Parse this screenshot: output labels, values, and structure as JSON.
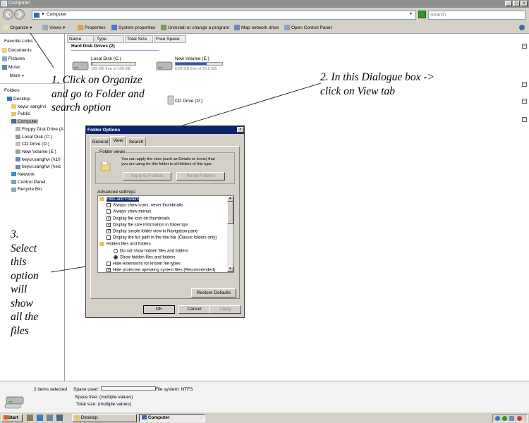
{
  "window": {
    "title": "Computer",
    "controls": [
      "_",
      "□",
      "×"
    ]
  },
  "address": {
    "path": "Computer",
    "search_placeholder": "Search"
  },
  "toolbar": {
    "organize": "Organize",
    "views": "Views",
    "properties": "Properties",
    "system_properties": "System properties",
    "uninstall": "Uninstall or change a program",
    "map_drive": "Map network drive",
    "control_panel": "Open Control Panel"
  },
  "nav": {
    "favorite_links_title": "Favorite Links",
    "favorites": [
      "Documents",
      "Pictures",
      "Music"
    ],
    "more": "More",
    "folders_title": "Folders",
    "tree": [
      "Desktop",
      "keyur sanghvi",
      "Public",
      "Computer",
      "Floppy Disk Drive (A",
      "Local Disk (C:)",
      "CD Drive (D:)",
      "New Volume (E:)",
      "keyur.sanghvi (\\\\10",
      "keyur.sanghvi (\\\\eic",
      "Network",
      "Control Panel",
      "Recycle Bin"
    ]
  },
  "columns": [
    "Name",
    "Type",
    "Total Size",
    "Free Space"
  ],
  "content": {
    "group_title": "Hard Disk Drives (2)",
    "drives": [
      {
        "name": "Local Disk (C:)",
        "free_text": "199 MB free of 200 MB",
        "used_fraction": 0.005
      },
      {
        "name": "New Volume (E:)",
        "free_text": "6.83 GB free of 20.6 GB",
        "used_fraction": 0.67
      }
    ],
    "cd_drive": "CD Drive (D:)"
  },
  "annotations": {
    "a1": [
      "1. Click on Organize",
      "and go to Folder and",
      "search option"
    ],
    "a2": [
      "2. In this Dialogue box ->",
      "click on View tab"
    ],
    "a3": [
      "3.",
      "Select",
      "this",
      "option",
      "will",
      "show",
      "all the",
      "files"
    ]
  },
  "dialog": {
    "title": "Folder Options",
    "close": "×",
    "tabs": [
      "General",
      "View",
      "Search"
    ],
    "folder_views_label": "Folder views",
    "folder_views_text": [
      "You can apply the view (such as Details or Icons) that",
      "you are using for this folder to all folders of this type."
    ],
    "apply_to_folders": "Apply to Folders",
    "reset_folders": "Reset Folders",
    "advanced_label": "Advanced settings:",
    "advanced_items": [
      {
        "kind": "folder",
        "label": "Files and Folders"
      },
      {
        "kind": "check",
        "checked": false,
        "label": "Always show icons, never thumbnails"
      },
      {
        "kind": "check",
        "checked": false,
        "label": "Always show menus"
      },
      {
        "kind": "check",
        "checked": true,
        "label": "Display file icon on thumbnails"
      },
      {
        "kind": "check",
        "checked": true,
        "label": "Display file size information in folder tips"
      },
      {
        "kind": "check",
        "checked": true,
        "label": "Display simple folder view in Navigation pane"
      },
      {
        "kind": "check",
        "checked": false,
        "label": "Display the full path in the title bar (Classic folders only)"
      },
      {
        "kind": "folder",
        "label": "Hidden files and folders"
      },
      {
        "kind": "radio",
        "checked": false,
        "label": "Do not show hidden files and folders"
      },
      {
        "kind": "radio",
        "checked": true,
        "label": "Show hidden files and folders"
      },
      {
        "kind": "check",
        "checked": false,
        "label": "Hide extensions for known file types"
      },
      {
        "kind": "check",
        "checked": true,
        "label": "Hide protected operating system files (Recommended)"
      }
    ],
    "check_mark": "✓",
    "restore_defaults": "Restore Defaults",
    "ok": "OK",
    "cancel": "Cancel",
    "apply": "Apply"
  },
  "status": {
    "items_selected": "2 items selected",
    "space_used_label": "Space used:",
    "file_system": "File system: NTFS",
    "space_free": "Space free: (multiple values)",
    "total_size": "Total size: (multiple values)"
  },
  "taskbar": {
    "start": "Start",
    "desktop": "Desktop",
    "computer": "Computer"
  }
}
